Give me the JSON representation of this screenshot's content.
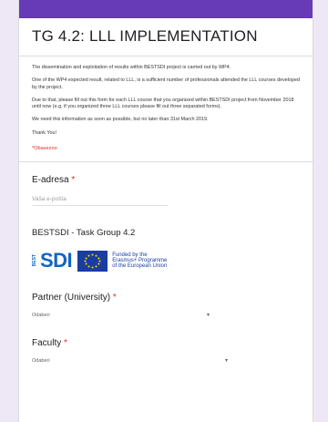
{
  "form": {
    "title": "TG 4.2: LLL IMPLEMENTATION",
    "description": [
      "The dissemination and exploitation of results within BESTSDI project is carried out by WP4.",
      "One of the WP4 expected result, related to LLL, is a sufficient number of professionals attended the LLL courses developed by the project.",
      "Due to that, please fill out this form for each LLL course that you organized within BESTSDI project from November 2018 until now (e.g. if you organized three LLL courses please fill out three separated forms).",
      "We need this information as soon as possible, but no later than 31st March 2019.",
      "Thank You!"
    ],
    "required_note": "*Obavezno"
  },
  "email": {
    "label": "E-adresa",
    "required_mark": "*",
    "placeholder": "Vaša e-pošta"
  },
  "section": {
    "title": "BESTSDI - Task Group 4.2"
  },
  "logo": {
    "best_letters": "BEST",
    "sdi_text": "SDI",
    "eu_text": [
      "Funded by the",
      "Erasmus+ Programme",
      "of the European Union"
    ]
  },
  "fields": [
    {
      "label": "Partner (University)",
      "required_mark": "*",
      "value": "Odaberi"
    },
    {
      "label": "Faculty",
      "required_mark": "*",
      "value": "Odaberi"
    }
  ],
  "colors": {
    "accent": "#673ab7",
    "background": "#ede7f6",
    "required": "#d93025",
    "logo_blue": "#1565c0",
    "eu_blue": "#1a3da0",
    "eu_star": "#ffdd00"
  }
}
